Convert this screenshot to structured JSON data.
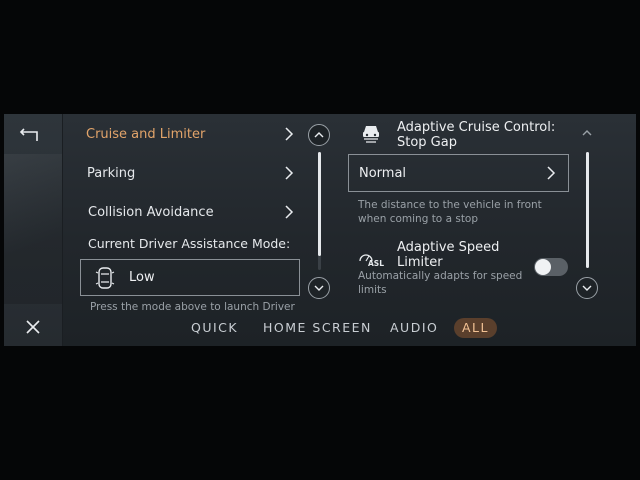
{
  "left_menu": {
    "items": [
      {
        "label": "Cruise and Limiter",
        "active": true
      },
      {
        "label": "Parking",
        "active": false
      },
      {
        "label": "Collision Avoidance",
        "active": false
      }
    ],
    "mode_heading": "Current Driver Assistance Mode:",
    "mode_value": "Low",
    "mode_hint": "Press the mode above to launch Driver"
  },
  "right_panel": {
    "acc_title": "Adaptive Cruise Control: Stop Gap",
    "acc_value": "Normal",
    "acc_description": "The distance to the vehicle in front when coming to a stop",
    "asl_icon_text": "ASL",
    "asl_title": "Adaptive Speed Limiter",
    "asl_description": "Automatically adapts for speed limits",
    "asl_enabled": false
  },
  "tabs": [
    {
      "label": "QUICK",
      "active": false
    },
    {
      "label": "HOME SCREEN",
      "active": false
    },
    {
      "label": "AUDIO",
      "active": false
    },
    {
      "label": "ALL",
      "active": true
    }
  ],
  "colors": {
    "accent": "#e2a46a",
    "active_tab_bg": "#5a3f2c",
    "panel_bg": "#262b30"
  },
  "icons": {
    "back": "back-arrow-icon",
    "close": "close-icon",
    "chevron": "chevron-right-icon",
    "scroll_up": "chevron-up-icon",
    "scroll_down": "chevron-down-icon",
    "car": "car-top-view-icon",
    "acc": "adaptive-cruise-icon",
    "asl": "speed-limiter-icon"
  }
}
